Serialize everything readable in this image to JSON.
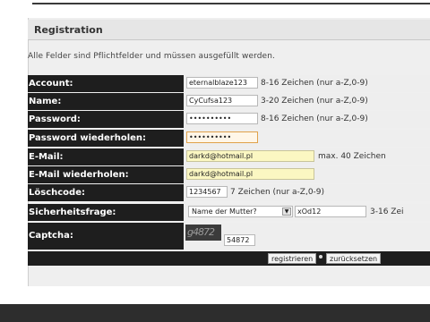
{
  "title": "Registration",
  "note": "Alle Felder sind Pflichtfelder und müssen ausgefüllt werden.",
  "rows": {
    "account": {
      "label": "Account:",
      "value": "eternalblaze123",
      "hint": "8-16 Zeichen (nur a-Z,0-9)"
    },
    "name": {
      "label": "Name:",
      "value": "CyCufsa123",
      "hint": "3-20 Zeichen (nur a-Z,0-9)"
    },
    "password": {
      "label": "Password:",
      "value": "••••••••••",
      "hint": "8-16 Zeichen (nur a-Z,0-9)"
    },
    "password2": {
      "label": "Password wiederholen:",
      "value": "••••••••••"
    },
    "email": {
      "label": "E-Mail:",
      "value": "darkd@hotmail.pl",
      "hint": "max. 40 Zeichen"
    },
    "email2": {
      "label": "E-Mail wiederholen:",
      "value": "darkd@hotmail.pl"
    },
    "delcode": {
      "label": "Löschcode:",
      "value": "1234567",
      "hint": "7 Zeichen (nur a-Z,0-9)"
    },
    "security": {
      "label": "Sicherheitsfrage:",
      "question": "Name der Mutter?",
      "answer": "xOd12",
      "hint": "3-16 Zei"
    },
    "captcha": {
      "label": "Captcha:",
      "image_text": "g4872",
      "value": "54872"
    }
  },
  "buttons": {
    "submit": "registrieren",
    "reset": "zurücksetzen"
  },
  "colors": {
    "label_bg": "#1e1e1e",
    "cell_bg": "#eeeeee",
    "input_yellow": "#fbf7c2",
    "focus_border": "#e0a14a"
  }
}
